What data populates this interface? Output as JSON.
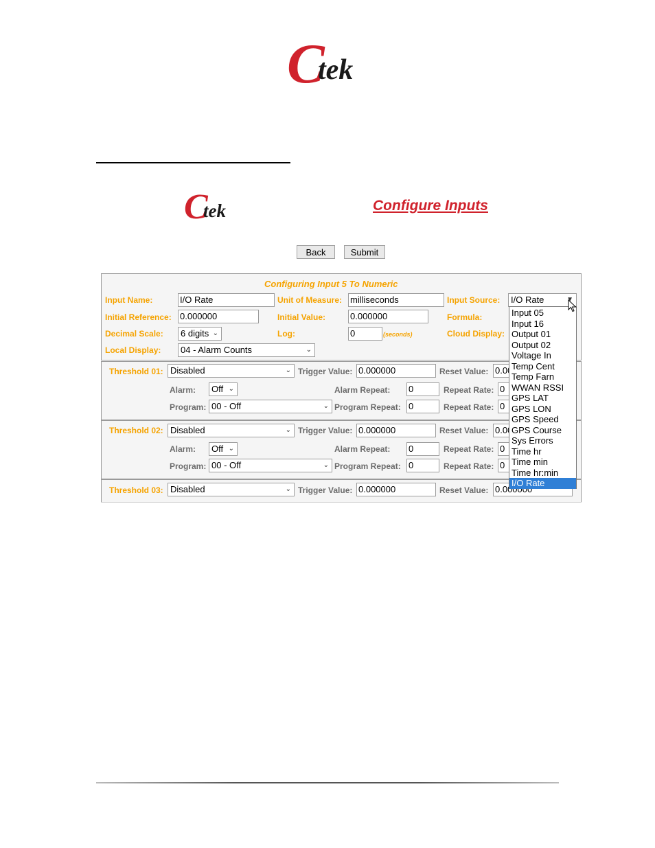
{
  "logo": {
    "c": "C",
    "tek": "tek"
  },
  "page": {
    "title": "Configure Inputs"
  },
  "buttons": {
    "back": "Back",
    "submit": "Submit"
  },
  "form": {
    "heading": "Configuring Input 5 To Numeric",
    "input_name_label": "Input Name:",
    "input_name_value": "I/O Rate",
    "unit_label": "Unit of Measure:",
    "unit_value": "milliseconds",
    "source_label": "Input Source:",
    "source_value": "I/O Rate",
    "initial_reference_label": "Initial Reference:",
    "initial_reference_value": "0.000000",
    "initial_value_label": "Initial Value:",
    "initial_value_value": "0.000000",
    "formula_label": "Formula:",
    "decimal_scale_label": "Decimal Scale:",
    "decimal_scale_value": "6 digits",
    "log_label": "Log:",
    "log_value": "0",
    "log_unit": "(seconds)",
    "cloud_display_label": "Cloud Display:",
    "local_display_label": "Local Display:",
    "local_display_value": "04 - Alarm Counts"
  },
  "thresholds": [
    {
      "label": "Threshold 01:",
      "mode": "Disabled",
      "trigger_label": "Trigger Value:",
      "trigger": "0.000000",
      "reset_label": "Reset Value:",
      "reset": "0.00",
      "alarm_label": "Alarm:",
      "alarm": "Off",
      "alarm_repeat_label": "Alarm Repeat:",
      "alarm_repeat": "0",
      "repeat_rate_label": "Repeat Rate:",
      "repeat_rate": "0",
      "program_label": "Program:",
      "program": "00 - Off",
      "program_repeat_label": "Program Repeat:",
      "program_repeat": "0",
      "repeat_rate2": "0"
    },
    {
      "label": "Threshold 02:",
      "mode": "Disabled",
      "trigger_label": "Trigger Value:",
      "trigger": "0.000000",
      "reset_label": "Reset Value:",
      "reset": "0.00",
      "alarm_label": "Alarm:",
      "alarm": "Off",
      "alarm_repeat_label": "Alarm Repeat:",
      "alarm_repeat": "0",
      "repeat_rate_label": "Repeat Rate:",
      "repeat_rate": "0",
      "program_label": "Program:",
      "program": "00 - Off",
      "program_repeat_label": "Program Repeat:",
      "program_repeat": "0",
      "repeat_rate2": "0"
    },
    {
      "label": "Threshold 03:",
      "mode": "Disabled",
      "trigger_label": "Trigger Value:",
      "trigger": "0.000000",
      "reset_label": "Reset Value:",
      "reset": "0.000000"
    }
  ],
  "source_options": [
    "Input 05",
    "Input 16",
    "Output 01",
    "Output 02",
    "Voltage In",
    "Temp Cent",
    "Temp Farn",
    "WWAN RSSI",
    "GPS LAT",
    "GPS LON",
    "GPS Speed",
    "GPS Course",
    "Sys Errors",
    "Time hr",
    "Time min",
    "Time hr:min",
    "I/O Rate"
  ],
  "colors": {
    "brand_red": "#d0222c",
    "label_orange": "#f5a300",
    "selected_blue": "#2f7fd6"
  }
}
